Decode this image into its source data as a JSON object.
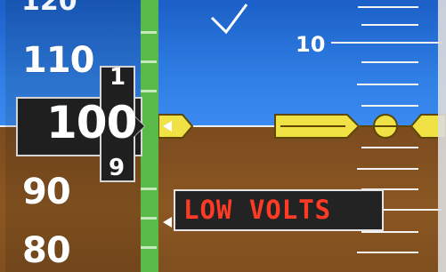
{
  "speed_tape": {
    "partial_top_label": "120",
    "label_110": "110",
    "label_90": "90",
    "label_80": "80",
    "current_value": "100",
    "rolling_upper_digit": "1",
    "rolling_lower_digit": "9"
  },
  "attitude": {
    "pitch_scale_label": "10"
  },
  "alert": {
    "text": "LOW VOLTS"
  },
  "colors": {
    "sky": "#2f7ee3",
    "ground": "#8b5722",
    "trend_bar": "#59ba48",
    "alert_text": "#ff3b26",
    "aircraft_symbol": "#f0e144"
  }
}
